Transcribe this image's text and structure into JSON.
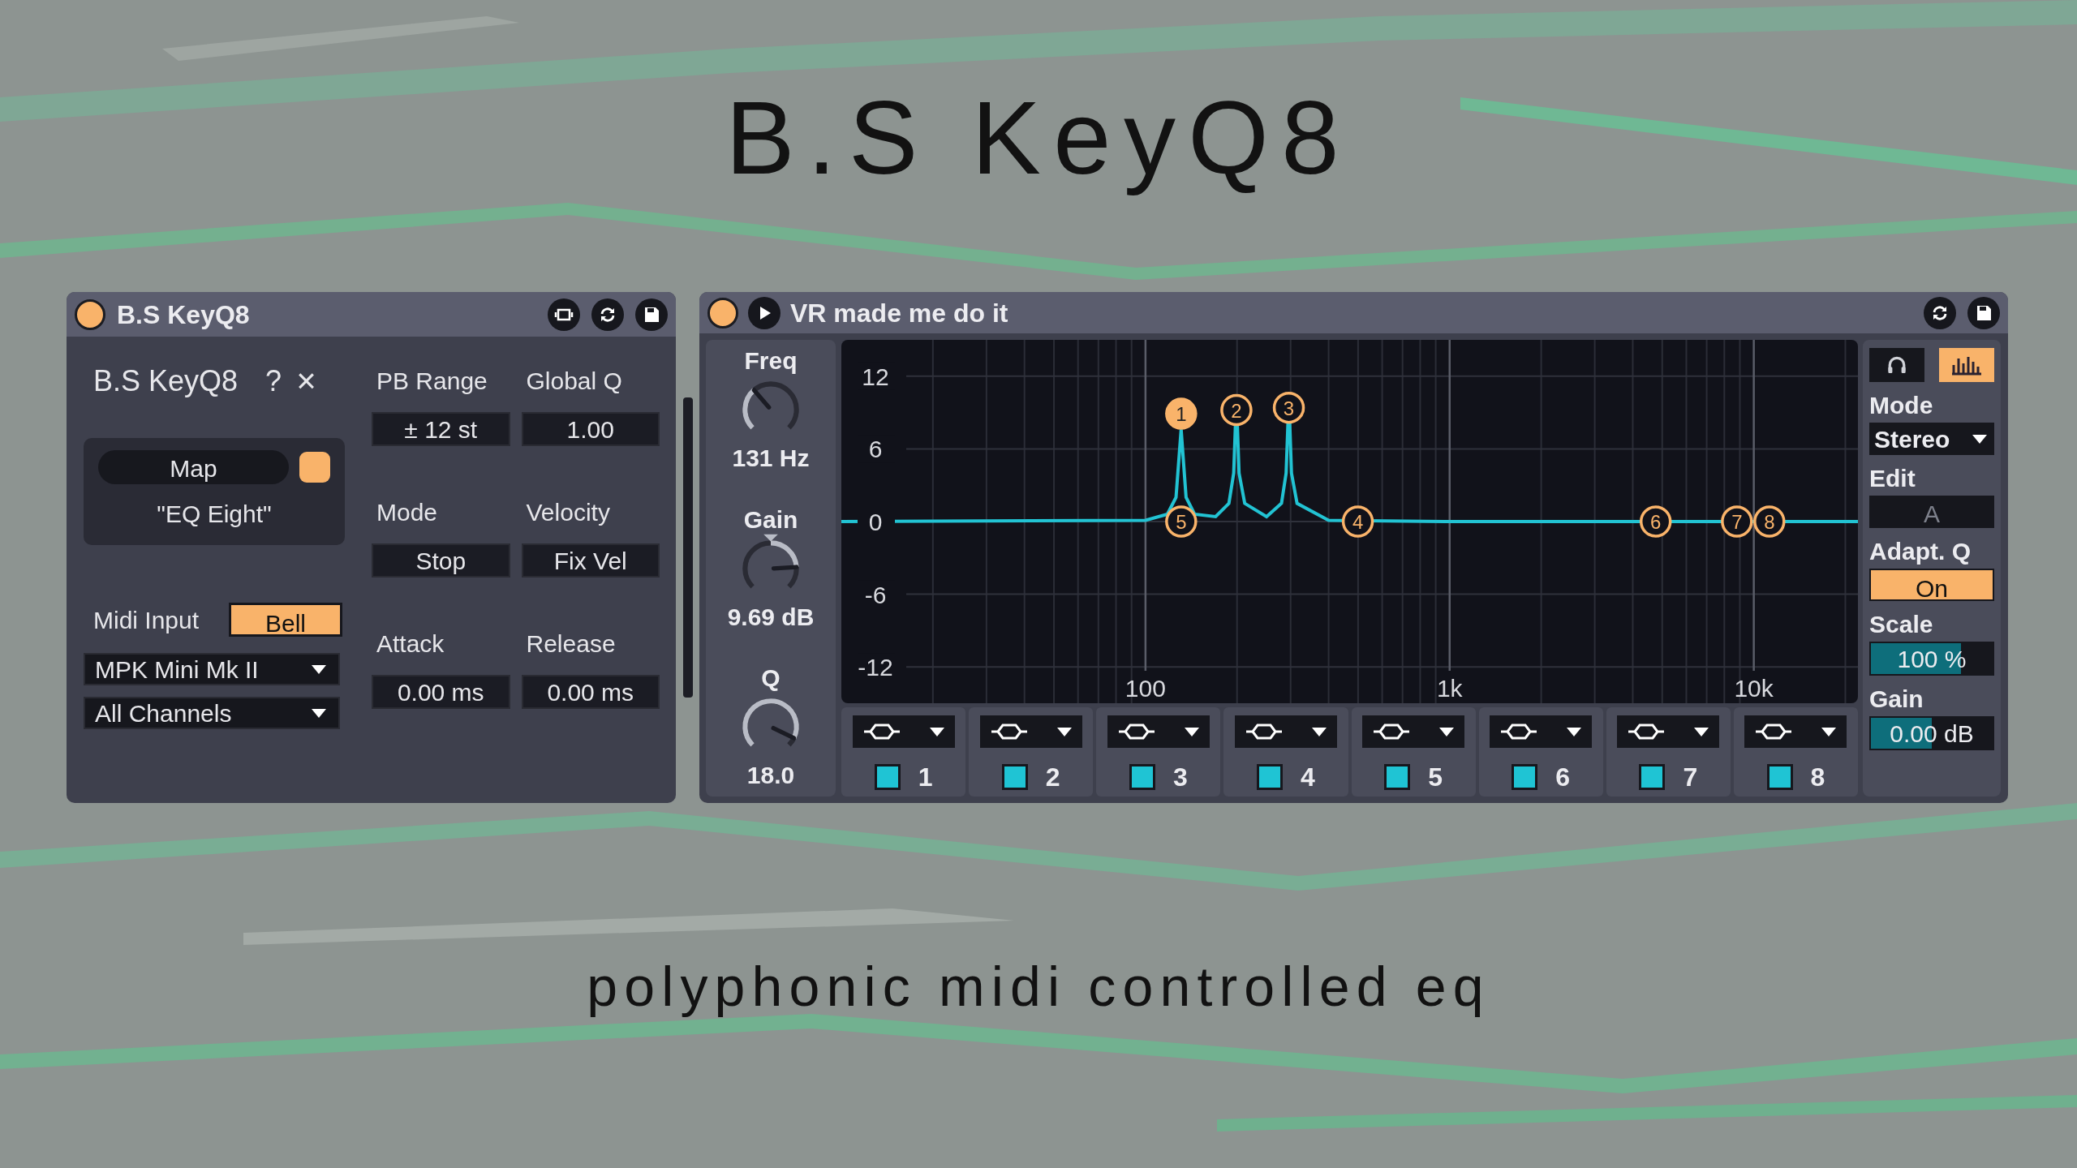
{
  "title": "B.S KeyQ8",
  "keyq8_device": {
    "title": "B.S KeyQ8",
    "on": true,
    "panel_title": "B.S KeyQ8",
    "help": "?",
    "close": "×",
    "map": {
      "label": "Map",
      "on": true,
      "target": "\"EQ Eight\""
    },
    "midi_input": {
      "label": "Midi Input",
      "button": "Bell",
      "active": true
    },
    "dropdowns": [
      {
        "value": "MPK Mini Mk II"
      },
      {
        "value": "All Channels"
      }
    ],
    "params": [
      {
        "label": "PB Range",
        "value": "± 12 st"
      },
      {
        "label": "Global Q",
        "value": "1.00"
      },
      {
        "label": "Mode",
        "value": "Stop"
      },
      {
        "label": "Velocity",
        "value": "Fix Vel"
      },
      {
        "label": "Attack",
        "value": "0.00 ms"
      },
      {
        "label": "Release",
        "value": "0.00 ms"
      }
    ]
  },
  "eq_device": {
    "title": "VR made me do it",
    "on": true,
    "knobs": [
      {
        "name": "Freq",
        "reading": "131 Hz"
      },
      {
        "name": "Gain",
        "reading": "9.69 dB"
      },
      {
        "name": "Q",
        "reading": "18.0"
      }
    ],
    "graph": {
      "y_labels": [
        "12",
        "6",
        "0",
        "-6",
        "-12"
      ],
      "x_labels": [
        "100",
        "1k",
        "10k"
      ],
      "markers": [
        {
          "text": "1",
          "selected": true
        },
        {
          "text": "2",
          "selected": false
        },
        {
          "text": "3",
          "selected": false
        },
        {
          "text": "5",
          "selected": false
        },
        {
          "text": "4",
          "selected": false
        },
        {
          "text": "6",
          "selected": false
        },
        {
          "text": "7",
          "selected": false
        },
        {
          "text": "8",
          "selected": false
        }
      ]
    },
    "bands": [
      {
        "number": "1",
        "on": true
      },
      {
        "number": "2",
        "on": true
      },
      {
        "number": "3",
        "on": true
      },
      {
        "number": "4",
        "on": true
      },
      {
        "number": "5",
        "on": true
      },
      {
        "number": "6",
        "on": true
      },
      {
        "number": "7",
        "on": true
      },
      {
        "number": "8",
        "on": true
      }
    ],
    "side": {
      "monitor_on": false,
      "spectrum_on": true,
      "mode": {
        "label": "Mode",
        "value": "Stereo"
      },
      "edit": {
        "label": "Edit",
        "value": "A",
        "disabled": true
      },
      "adapt_q": {
        "label": "Adapt. Q",
        "value": "On",
        "on": true
      },
      "scale": {
        "label": "Scale",
        "value": "100 %",
        "level": 0.74
      },
      "gain": {
        "label": "Gain",
        "value": "0.00 dB",
        "level": 0.5
      }
    }
  },
  "subtitle": "polyphonic midi controlled eq"
}
